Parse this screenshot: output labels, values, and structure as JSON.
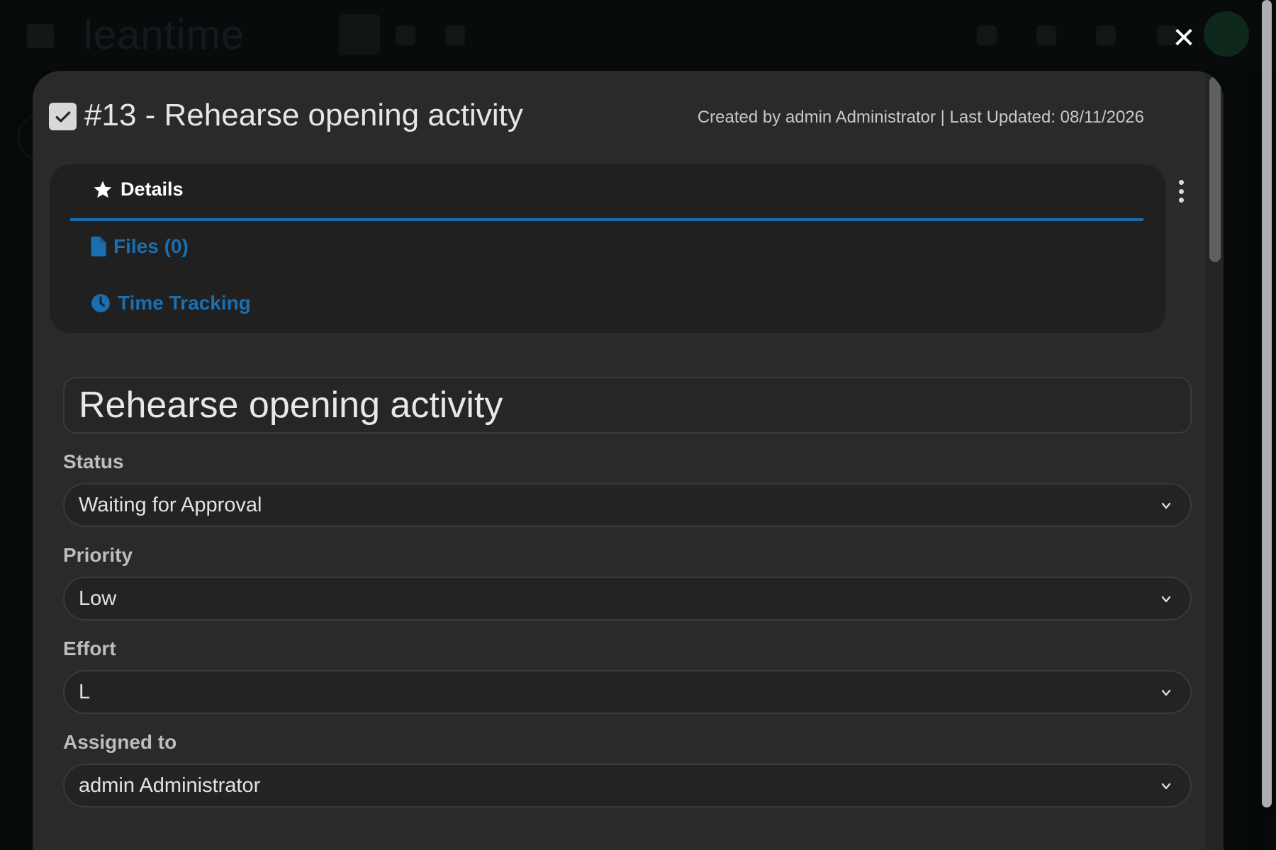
{
  "app": {
    "logo_text": "leantime"
  },
  "modal": {
    "title": "#13 - Rehearse opening activity",
    "meta": "Created by admin Administrator | Last Updated: 08/11/2026",
    "close_glyph": "✕",
    "tabs": [
      {
        "label": "Details",
        "icon": "star-icon",
        "active": true
      },
      {
        "label": "Files (0)",
        "icon": "file-icon",
        "active": false
      },
      {
        "label": "Time Tracking",
        "icon": "clock-icon",
        "active": false
      }
    ],
    "form": {
      "title_value": "Rehearse opening activity",
      "status": {
        "label": "Status",
        "value": "Waiting for Approval"
      },
      "priority": {
        "label": "Priority",
        "value": "Low"
      },
      "effort": {
        "label": "Effort",
        "value": "L"
      },
      "assigned": {
        "label": "Assigned to",
        "value": "admin Administrator"
      }
    }
  },
  "colors": {
    "accent": "#1a6fb0",
    "modal_bg": "#2a2a2a"
  }
}
